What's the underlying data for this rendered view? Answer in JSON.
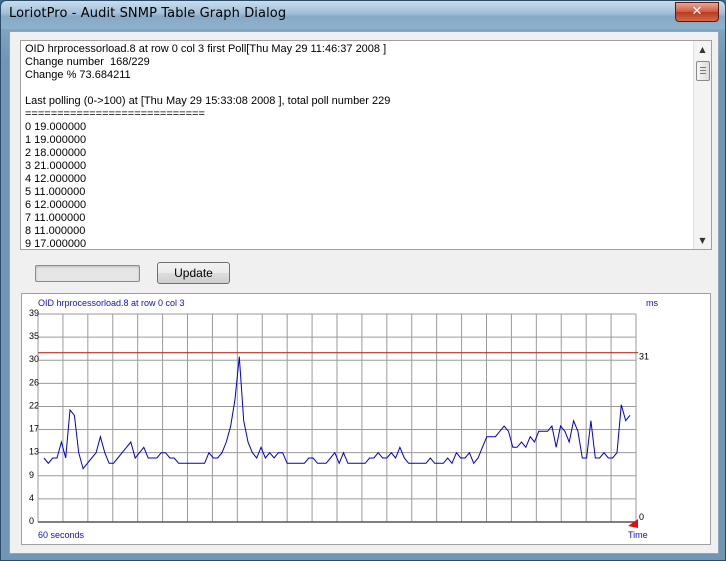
{
  "window": {
    "title": "LoriotPro - Audit SNMP Table Graph Dialog",
    "close_glyph": "✕"
  },
  "text_area": {
    "lines": [
      "OID hrprocessorload.8 at row 0 col 3 first Poll[Thu May 29 11:46:37 2008 ]",
      "Change number  168/229",
      "Change % 73.684211",
      "",
      "Last polling (0->100) at [Thu May 29 15:33:08 2008 ], total poll number 229",
      "============================",
      "0 19.000000",
      "1 19.000000",
      "2 18.000000",
      "3 21.000000",
      "4 12.000000",
      "5 11.000000",
      "6 12.000000",
      "7 11.000000",
      "8 11.000000",
      "9 17.000000"
    ]
  },
  "progress": {
    "value": 0
  },
  "buttons": {
    "update_label": "Update"
  },
  "icons": {
    "scroll_up": "scroll-up-arrow-icon",
    "scroll_down": "scroll-down-arrow-icon",
    "close": "close-icon",
    "marker": "red-triangle-marker-icon"
  },
  "colors": {
    "series": "#0000cc",
    "threshold": "#c03020",
    "grid": "#9a9a9a",
    "label": "#1010d0"
  },
  "chart_data": {
    "type": "line",
    "title": "OID hrprocessorload.8 at row 0 col 3",
    "unit_label": "ms",
    "xlabel_left": "60 seconds",
    "xlabel_right": "Time",
    "yticks": [
      "39",
      "35",
      "30",
      "26",
      "22",
      "17",
      "13",
      "9",
      "4",
      "0"
    ],
    "ylim": [
      0,
      39
    ],
    "threshold": {
      "value": 31,
      "label": "31"
    },
    "grid": true,
    "series": [
      {
        "values": [
          12,
          11,
          12,
          12,
          15,
          12,
          21,
          20,
          13,
          10,
          11,
          12,
          13,
          16,
          13,
          11,
          11,
          12,
          13,
          14,
          15,
          12,
          13,
          14,
          12,
          12,
          12,
          13,
          13,
          12,
          12,
          11,
          11,
          11,
          11,
          11,
          11,
          11,
          13,
          12,
          12,
          13,
          15,
          18,
          23,
          31,
          19,
          15,
          13,
          12,
          14,
          12,
          13,
          12,
          13,
          13,
          11,
          11,
          11,
          11,
          11,
          12,
          12,
          11,
          11,
          11,
          12,
          13,
          11,
          13,
          11,
          11,
          11,
          11,
          11,
          12,
          12,
          13,
          12,
          12,
          13,
          12,
          14,
          12,
          11,
          11,
          11,
          11,
          11,
          12,
          11,
          11,
          11,
          12,
          11,
          13,
          12,
          12,
          13,
          11,
          12,
          14,
          16,
          16,
          16,
          17,
          18,
          17,
          14,
          14,
          15,
          14,
          16,
          15,
          17,
          17,
          17,
          18,
          14,
          18,
          17,
          15,
          19,
          17,
          12,
          12,
          19,
          12,
          12,
          13,
          12,
          12,
          13,
          22,
          19,
          20
        ]
      }
    ]
  }
}
